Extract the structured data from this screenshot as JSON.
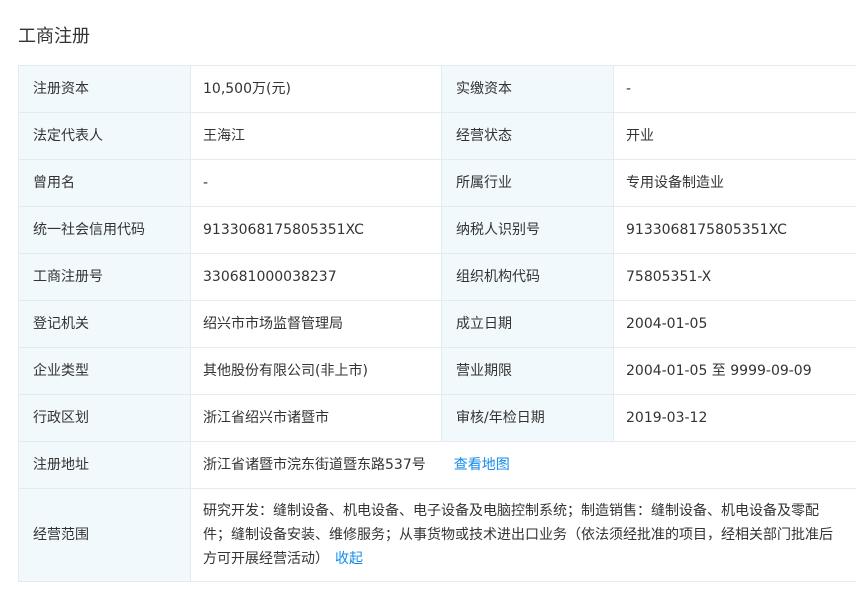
{
  "section": {
    "title": "工商注册"
  },
  "rows": [
    {
      "l1": "注册资本",
      "v1": "10,500万(元)",
      "l2": "实缴资本",
      "v2": "-"
    },
    {
      "l1": "法定代表人",
      "v1": "王海江",
      "l2": "经营状态",
      "v2": "开业"
    },
    {
      "l1": "曾用名",
      "v1": "-",
      "l2": "所属行业",
      "v2": "专用设备制造业"
    },
    {
      "l1": "统一社会信用代码",
      "v1": "9133068175805351XC",
      "l2": "纳税人识别号",
      "v2": "9133068175805351XC"
    },
    {
      "l1": "工商注册号",
      "v1": "330681000038237",
      "l2": "组织机构代码",
      "v2": "75805351-X"
    },
    {
      "l1": "登记机关",
      "v1": "绍兴市市场监督管理局",
      "l2": "成立日期",
      "v2": "2004-01-05"
    },
    {
      "l1": "企业类型",
      "v1": "其他股份有限公司(非上市)",
      "l2": "营业期限",
      "v2": "2004-01-05 至 9999-09-09"
    },
    {
      "l1": "行政区划",
      "v1": "浙江省绍兴市诸暨市",
      "l2": "审核/年检日期",
      "v2": "2019-03-12"
    }
  ],
  "address": {
    "label": "注册地址",
    "value": "浙江省诸暨市浣东街道暨东路537号",
    "map_link": "查看地图"
  },
  "scope": {
    "label": "经营范围",
    "value": "研究开发：缝制设备、机电设备、电子设备及电脑控制系统；制造销售：缝制设备、机电设备及零配件；缝制设备安装、维修服务；从事货物或技术进出口业务（依法须经批准的项目，经相关部门批准后方可开展经营活动）",
    "collapse_link": "收起"
  },
  "colors": {
    "label_bg": "#f2f9fc",
    "border": "#e4eaf0",
    "link": "#128bed",
    "text": "#333333"
  }
}
